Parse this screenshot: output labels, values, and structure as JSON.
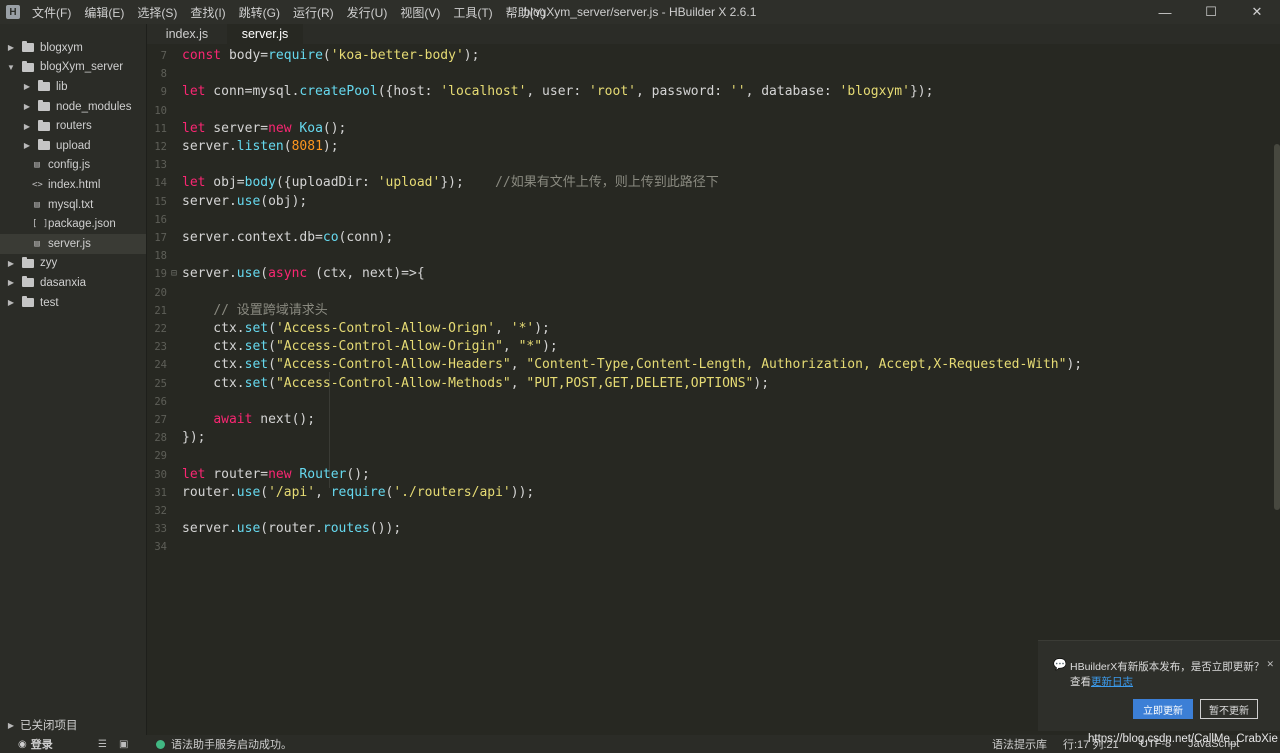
{
  "window": {
    "title": "blogXym_server/server.js - HBuilder X 2.6.1",
    "logo": "H",
    "menu": [
      "文件(F)",
      "编辑(E)",
      "选择(S)",
      "查找(I)",
      "跳转(G)",
      "运行(R)",
      "发行(U)",
      "视图(V)",
      "工具(T)",
      "帮助(Y)"
    ],
    "controls": {
      "minimize": "—",
      "maximize": "☐",
      "close": "✕"
    }
  },
  "tabs": [
    {
      "label": "index.js",
      "active": false
    },
    {
      "label": "server.js",
      "active": true
    }
  ],
  "sidebar": {
    "tree": [
      {
        "label": "blogxym",
        "type": "folder",
        "expanded": false,
        "depth": 0
      },
      {
        "label": "blogXym_server",
        "type": "folder",
        "expanded": true,
        "depth": 0
      },
      {
        "label": "lib",
        "type": "folder",
        "expanded": false,
        "depth": 1
      },
      {
        "label": "node_modules",
        "type": "folder",
        "expanded": false,
        "depth": 1
      },
      {
        "label": "routers",
        "type": "folder",
        "expanded": false,
        "depth": 1
      },
      {
        "label": "upload",
        "type": "folder",
        "expanded": false,
        "depth": 1
      },
      {
        "label": "config.js",
        "type": "js",
        "depth": 1
      },
      {
        "label": "index.html",
        "type": "html",
        "depth": 1
      },
      {
        "label": "mysql.txt",
        "type": "txt",
        "depth": 1
      },
      {
        "label": "package.json",
        "type": "json",
        "depth": 1
      },
      {
        "label": "server.js",
        "type": "js",
        "depth": 1,
        "selected": true
      },
      {
        "label": "zyy",
        "type": "folder",
        "expanded": false,
        "depth": 0
      },
      {
        "label": "dasanxia",
        "type": "folder",
        "expanded": false,
        "depth": 0
      },
      {
        "label": "test",
        "type": "folder",
        "expanded": false,
        "depth": 0
      }
    ],
    "closed_projects": "已关闭项目"
  },
  "editor": {
    "line_numbers": [
      "7",
      "8",
      "9",
      "10",
      "11",
      "12",
      "13",
      "14",
      "15",
      "16",
      "17",
      "18",
      "19",
      "20",
      "21",
      "22",
      "23",
      "24",
      "25",
      "26",
      "27",
      "28",
      "29",
      "30",
      "31",
      "32",
      "33",
      "34"
    ],
    "lines": [
      "const body=require('koa-better-body');",
      "",
      "let conn=mysql.createPool({host: 'localhost', user: 'root', password: '', database: 'blogxym'});",
      "",
      "let server=new Koa();",
      "server.listen(8081);",
      "",
      "let obj=body({uploadDir: 'upload'});    //如果有文件上传，则上传到此路径下",
      "server.use(obj);",
      "",
      "server.context.db=co(conn);",
      "",
      "server.use(async (ctx, next)=>{",
      "",
      "    // 设置跨域请求头",
      "    ctx.set('Access-Control-Allow-Orign', '*');",
      "    ctx.set(\"Access-Control-Allow-Origin\", \"*\");",
      "    ctx.set(\"Access-Control-Allow-Headers\", \"Content-Type,Content-Length, Authorization, Accept,X-Requested-With\");",
      "    ctx.set(\"Access-Control-Allow-Methods\", \"PUT,POST,GET,DELETE,OPTIONS\");",
      "",
      "    await next();",
      "});",
      "",
      "let router=new Router();",
      "router.use('/api', require('./routers/api'));",
      "",
      "server.use(router.routes());",
      ""
    ],
    "fold_marker": "⊟"
  },
  "statusbar": {
    "login": "登录",
    "message": "语法助手服务启动成功。",
    "hint": "语法提示库",
    "position": "行:17  列:21",
    "encoding": "UTF-8",
    "language": "JavaScript"
  },
  "notification": {
    "message": "HBuilderX有新版本发布，是否立即更新？",
    "view_prefix": "查看",
    "changelog_link": "更新日志",
    "update_button": "立即更新",
    "later_button": "暂不更新",
    "close": "✕"
  },
  "watermark": "https://blog.csdn.net/CallMe_CrabXie"
}
